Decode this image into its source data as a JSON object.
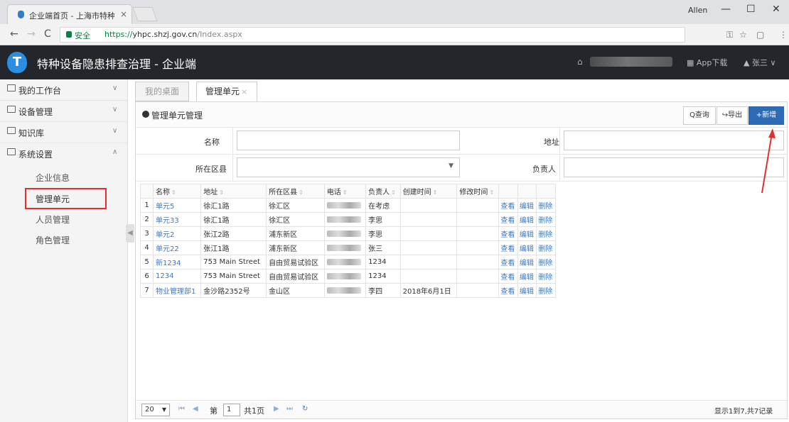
{
  "browser": {
    "tab_title": "企业端首页 - 上海市特种",
    "tab_close": "×",
    "user": "Allen",
    "win_min": "—",
    "win_max": "☐",
    "win_close": "✕",
    "back": "←",
    "forward": "→",
    "reload": "C",
    "secure_label": "安全",
    "url_scheme": "https://",
    "url_host": "yhpc.shzj.gov.cn",
    "url_path": "/Index.aspx",
    "key_icon": "⚿",
    "star_icon": "☆",
    "ext_icon": "▢",
    "menu_icon": "⋮"
  },
  "app": {
    "title": "特种设备隐患排查治理 - 企业端",
    "logo_text": "T",
    "home_icon": "⌂",
    "app_download": "▦ App下载",
    "user_menu": "▲ 张三 ∨"
  },
  "sidebar": {
    "menus": [
      {
        "label": "我的工作台",
        "chevron": "∨"
      },
      {
        "label": "设备管理",
        "chevron": "∨"
      },
      {
        "label": "知识库",
        "chevron": "∨"
      },
      {
        "label": "系统设置",
        "chevron": "∧"
      }
    ],
    "subitems": [
      {
        "label": "企业信息"
      },
      {
        "label": "管理单元"
      },
      {
        "label": "人员管理"
      },
      {
        "label": "角色管理"
      }
    ],
    "collapse_icon": "◀"
  },
  "content_tabs": {
    "tab1": "我的桌面",
    "tab2": "管理单元",
    "tab2_close": "×"
  },
  "panel": {
    "title": "管理单元管理",
    "query_btn": "Q查询",
    "export_btn": "↪导出",
    "add_btn": "+新增"
  },
  "form": {
    "name_label": "名称",
    "name_value": "",
    "address_label": "地址",
    "address_value": "",
    "district_label": "所在区县",
    "district_value": "",
    "owner_label": "负责人",
    "owner_value": "",
    "dropdown_icon": "▼"
  },
  "table": {
    "sort_icon": "⇕",
    "headers": [
      "名称",
      "地址",
      "所在区县",
      "电话",
      "负责人",
      "创建时间",
      "修改时间"
    ],
    "rows": [
      {
        "num": "1",
        "name": "单元5",
        "address": "徐汇1路",
        "district": "徐汇区",
        "phone_visible": "",
        "owner": "在考虑",
        "created": "",
        "modified": ""
      },
      {
        "num": "2",
        "name": "单元33",
        "address": "徐汇1路",
        "district": "徐汇区",
        "phone_visible": "",
        "owner": "李思",
        "created": "",
        "modified": ""
      },
      {
        "num": "3",
        "name": "单元2",
        "address": "张江2路",
        "district": "浦东新区",
        "phone_visible": "",
        "owner": "李思",
        "created": "",
        "modified": ""
      },
      {
        "num": "4",
        "name": "单元22",
        "address": "张江1路",
        "district": "浦东新区",
        "phone_visible": "",
        "owner": "张三",
        "created": "",
        "modified": ""
      },
      {
        "num": "5",
        "name": "新1234",
        "address": "753 Main Street",
        "district": "自由贸易试验区",
        "phone_visible": "",
        "owner": "1234",
        "created": "",
        "modified": ""
      },
      {
        "num": "6",
        "name": "1234",
        "address": "753 Main Street",
        "district": "自由贸易试验区",
        "phone_visible": "",
        "owner": "1234",
        "created": "",
        "modified": ""
      },
      {
        "num": "7",
        "name": "物业管理部1",
        "address": "金沙路2352号",
        "district": "金山区",
        "phone_visible": "",
        "owner": "李四",
        "created": "2018年6月1日",
        "modified": ""
      }
    ],
    "action_view": "查看",
    "action_edit": "编辑",
    "action_delete": "删除"
  },
  "pager": {
    "page_size": "20",
    "page_prefix": "第",
    "page_value": "1",
    "page_total": "共1页",
    "first": "⏮",
    "prev": "◀",
    "next": "▶",
    "last": "⏭",
    "refresh": "↻",
    "info": "显示1到7,共7记录"
  },
  "colors": {
    "header_bg": "#23262b",
    "accent_blue": "#2e6bb7",
    "link_blue": "#3b78c2",
    "highlight_red": "#e03030"
  }
}
